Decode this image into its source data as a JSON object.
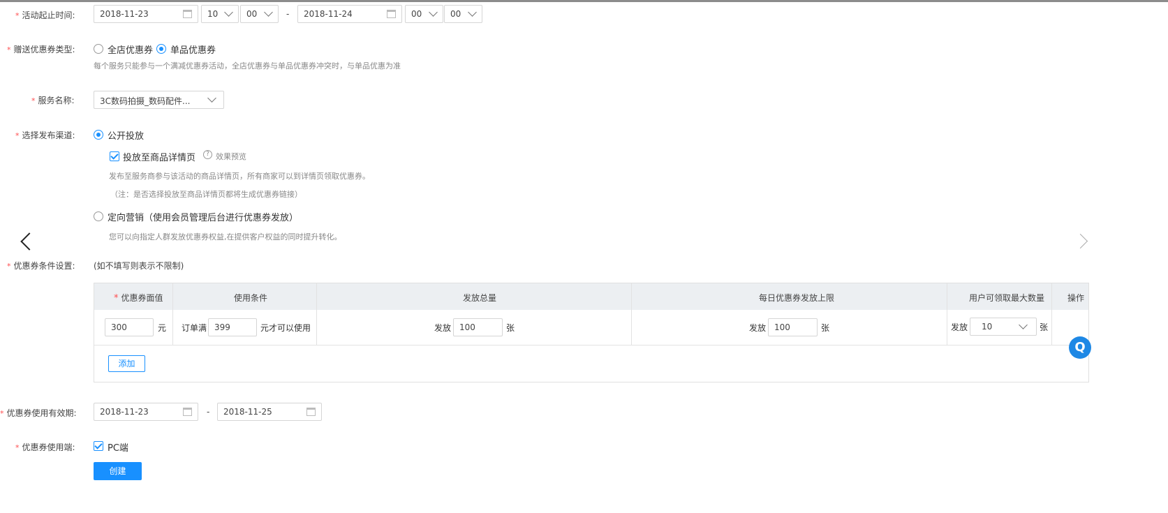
{
  "activity_time": {
    "label": "活动起止时间:",
    "start_date": "2018-11-23",
    "start_hour": "10",
    "start_minute": "00",
    "separator": "-",
    "end_date": "2018-11-24",
    "end_hour": "00",
    "end_minute": "00"
  },
  "coupon_type": {
    "label": "赠送优惠券类型:",
    "options": [
      "全店优惠券",
      "单品优惠券"
    ],
    "selected": "单品优惠券",
    "hint": "每个服务只能参与一个满减优惠券活动，全店优惠券与单品优惠券冲突时，与单品优惠为准"
  },
  "service_name": {
    "label": "服务名称:",
    "value": "3C数码拍摄_数码配件..."
  },
  "channel": {
    "label": "选择发布渠道:",
    "public_label": "公开投放",
    "detail_page_checkbox": "投放至商品详情页",
    "preview_link": "效果预览",
    "help_glyph": "?",
    "public_hint1": "发布至服务商参与该活动的商品详情页，所有商家可以到详情页领取优惠券。",
    "public_hint2": "（注：是否选择投放至商品详情页都将生成优惠券链接）",
    "targeted_label": "定向营销（使用会员管理后台进行优惠券发放）",
    "targeted_hint": "您可以向指定人群发放优惠券权益,在提供客户权益的同时提升转化。"
  },
  "conditions": {
    "label": "优惠券条件设置:",
    "note": "(如不填写则表示不限制)",
    "headers": [
      "优惠券面值",
      "使用条件",
      "发放总量",
      "每日优惠券发放上限",
      "用户可领取最大数量",
      "操作"
    ],
    "row": {
      "face_value": "300",
      "face_unit": "元",
      "cond_prefix": "订单满",
      "cond_value": "399",
      "cond_suffix": "元才可以使用",
      "total_prefix": "发放",
      "total_value": "100",
      "total_unit": "张",
      "daily_prefix": "发放",
      "daily_value": "100",
      "daily_unit": "张",
      "max_prefix": "发放",
      "max_value": "10",
      "max_unit": "张"
    },
    "add_button": "添加"
  },
  "validity": {
    "label": "优惠券使用有效期:",
    "start": "2018-11-23",
    "separator": "-",
    "end": "2018-11-25"
  },
  "platform": {
    "label": "优惠券使用端:",
    "option": "PC端"
  },
  "create_button": "创建",
  "floating_help": "Q",
  "required_mark": "*",
  "colors": {
    "primary": "#1890ff",
    "required": "#ff4d4f"
  }
}
